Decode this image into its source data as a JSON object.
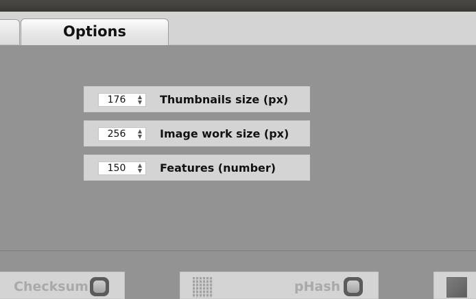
{
  "tabs": {
    "options_label": "Options"
  },
  "options": [
    {
      "value": "176",
      "label": "Thumbnails size (px)"
    },
    {
      "value": "256",
      "label": "Image work size (px)"
    },
    {
      "value": "150",
      "label": "Features (number)"
    }
  ],
  "methods": {
    "checksum_label": "Checksum",
    "phash_label": "pHash"
  },
  "icons": {
    "spin_up": "▲",
    "spin_down": "▼"
  }
}
